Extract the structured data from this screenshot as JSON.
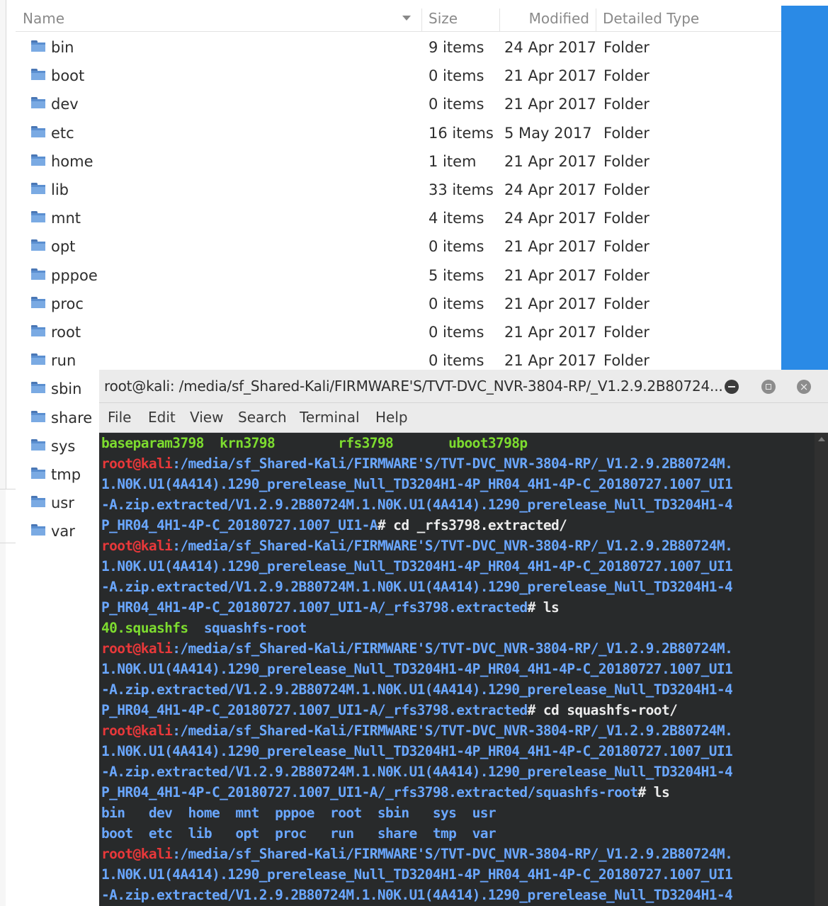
{
  "file_manager": {
    "columns": {
      "name": "Name",
      "size": "Size",
      "modified": "Modified",
      "type": "Detailed Type"
    },
    "rows": [
      {
        "name": "bin",
        "size": "9 items",
        "modified": "24 Apr 2017",
        "type": "Folder"
      },
      {
        "name": "boot",
        "size": "0 items",
        "modified": "21 Apr 2017",
        "type": "Folder"
      },
      {
        "name": "dev",
        "size": "0 items",
        "modified": "21 Apr 2017",
        "type": "Folder"
      },
      {
        "name": "etc",
        "size": "16 items",
        "modified": "5 May 2017",
        "type": "Folder"
      },
      {
        "name": "home",
        "size": "1 item",
        "modified": "21 Apr 2017",
        "type": "Folder"
      },
      {
        "name": "lib",
        "size": "33 items",
        "modified": "24 Apr 2017",
        "type": "Folder"
      },
      {
        "name": "mnt",
        "size": "4 items",
        "modified": "24 Apr 2017",
        "type": "Folder"
      },
      {
        "name": "opt",
        "size": "0 items",
        "modified": "21 Apr 2017",
        "type": "Folder"
      },
      {
        "name": "pppoe",
        "size": "5 items",
        "modified": "21 Apr 2017",
        "type": "Folder"
      },
      {
        "name": "proc",
        "size": "0 items",
        "modified": "21 Apr 2017",
        "type": "Folder"
      },
      {
        "name": "root",
        "size": "0 items",
        "modified": "21 Apr 2017",
        "type": "Folder"
      },
      {
        "name": "run",
        "size": "0 items",
        "modified": "21 Apr 2017",
        "type": "Folder"
      },
      {
        "name": "sbin",
        "size": "",
        "modified": "",
        "type": ""
      },
      {
        "name": "share",
        "size": "",
        "modified": "",
        "type": ""
      },
      {
        "name": "sys",
        "size": "",
        "modified": "",
        "type": ""
      },
      {
        "name": "tmp",
        "size": "",
        "modified": "",
        "type": ""
      },
      {
        "name": "usr",
        "size": "",
        "modified": "",
        "type": ""
      },
      {
        "name": "var",
        "size": "",
        "modified": "",
        "type": ""
      }
    ],
    "accent_color": "#2a8ae6"
  },
  "terminal": {
    "title": "root@kali: /media/sf_Shared-Kali/FIRMWARE'S/TVT-DVC_NVR-3804-RP/_V1.2.9.2B80724...",
    "window_buttons": {
      "minimize": "minimize-icon",
      "maximize": "maximize-icon",
      "close": "×"
    },
    "menu": [
      "File",
      "Edit",
      "View",
      "Search",
      "Terminal",
      "Help"
    ],
    "prompt_user": "root@kali",
    "lines": [
      [
        [
          "green",
          "baseparam3798  krn3798        rfs3798       uboot3798p"
        ]
      ],
      [
        [
          "red",
          "root@kali"
        ],
        [
          "blue",
          ":/media/sf_Shared-Kali/FIRMWARE'S/TVT-DVC_NVR-3804-RP/_V1.2.9.2B80724M."
        ]
      ],
      [
        [
          "blue",
          "1.N0K.U1(4A414).1290_prerelease_Null_TD3204H1-4P_HR04_4H1-4P-C_20180727.1007_UI1"
        ]
      ],
      [
        [
          "blue",
          "-A.zip.extracted/V1.2.9.2B80724M.1.N0K.U1(4A414).1290_prerelease_Null_TD3204H1-4"
        ]
      ],
      [
        [
          "blue",
          "P_HR04_4H1-4P-C_20180727.1007_UI1-A"
        ],
        [
          "white",
          "# cd _rfs3798.extracted/"
        ]
      ],
      [
        [
          "red",
          "root@kali"
        ],
        [
          "blue",
          ":/media/sf_Shared-Kali/FIRMWARE'S/TVT-DVC_NVR-3804-RP/_V1.2.9.2B80724M."
        ]
      ],
      [
        [
          "blue",
          "1.N0K.U1(4A414).1290_prerelease_Null_TD3204H1-4P_HR04_4H1-4P-C_20180727.1007_UI1"
        ]
      ],
      [
        [
          "blue",
          "-A.zip.extracted/V1.2.9.2B80724M.1.N0K.U1(4A414).1290_prerelease_Null_TD3204H1-4"
        ]
      ],
      [
        [
          "blue",
          "P_HR04_4H1-4P-C_20180727.1007_UI1-A/_rfs3798.extracted"
        ],
        [
          "white",
          "# ls"
        ]
      ],
      [
        [
          "green",
          "40.squashfs"
        ],
        [
          "blue",
          "  squashfs-root"
        ]
      ],
      [
        [
          "red",
          "root@kali"
        ],
        [
          "blue",
          ":/media/sf_Shared-Kali/FIRMWARE'S/TVT-DVC_NVR-3804-RP/_V1.2.9.2B80724M."
        ]
      ],
      [
        [
          "blue",
          "1.N0K.U1(4A414).1290_prerelease_Null_TD3204H1-4P_HR04_4H1-4P-C_20180727.1007_UI1"
        ]
      ],
      [
        [
          "blue",
          "-A.zip.extracted/V1.2.9.2B80724M.1.N0K.U1(4A414).1290_prerelease_Null_TD3204H1-4"
        ]
      ],
      [
        [
          "blue",
          "P_HR04_4H1-4P-C_20180727.1007_UI1-A/_rfs3798.extracted"
        ],
        [
          "white",
          "# cd squashfs-root/"
        ]
      ],
      [
        [
          "red",
          "root@kali"
        ],
        [
          "blue",
          ":/media/sf_Shared-Kali/FIRMWARE'S/TVT-DVC_NVR-3804-RP/_V1.2.9.2B80724M."
        ]
      ],
      [
        [
          "blue",
          "1.N0K.U1(4A414).1290_prerelease_Null_TD3204H1-4P_HR04_4H1-4P-C_20180727.1007_UI1"
        ]
      ],
      [
        [
          "blue",
          "-A.zip.extracted/V1.2.9.2B80724M.1.N0K.U1(4A414).1290_prerelease_Null_TD3204H1-4"
        ]
      ],
      [
        [
          "blue",
          "P_HR04_4H1-4P-C_20180727.1007_UI1-A/_rfs3798.extracted/squashfs-root"
        ],
        [
          "white",
          "# ls"
        ]
      ],
      [
        [
          "blue",
          "bin   dev  home  mnt  pppoe  root  sbin   sys  usr"
        ]
      ],
      [
        [
          "blue",
          "boot  etc  lib   opt  proc   run   share  tmp  var"
        ]
      ],
      [
        [
          "red",
          "root@kali"
        ],
        [
          "blue",
          ":/media/sf_Shared-Kali/FIRMWARE'S/TVT-DVC_NVR-3804-RP/_V1.2.9.2B80724M."
        ]
      ],
      [
        [
          "blue",
          "1.N0K.U1(4A414).1290_prerelease_Null_TD3204H1-4P_HR04_4H1-4P-C_20180727.1007_UI1"
        ]
      ],
      [
        [
          "blue",
          "-A.zip.extracted/V1.2.9.2B80724M.1.N0K.U1(4A414).1290_prerelease_Null_TD3204H1-4"
        ]
      ]
    ],
    "colors": {
      "prompt_user": "#e8383a",
      "path": "#6aa7ff",
      "exec": "#7ddc2f",
      "text": "#ececec",
      "background": "#282a2b"
    }
  }
}
